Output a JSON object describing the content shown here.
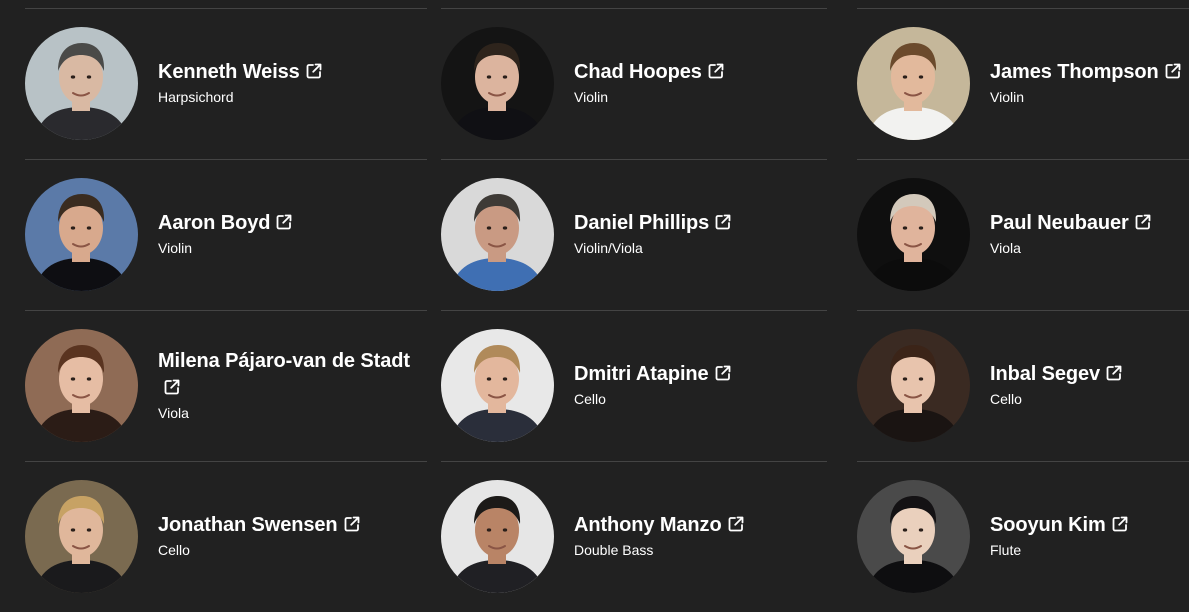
{
  "artists": [
    {
      "name": "Kenneth Weiss",
      "role": "Harpsichord",
      "photo": "portrait-photo",
      "bg": "#b8c2c6",
      "skin": "#d9b9a3",
      "hair": "#4a4a48",
      "shirt": "#2a2a2e"
    },
    {
      "name": "Chad Hoopes",
      "role": "Violin",
      "photo": "portrait-photo",
      "bg": "#141414",
      "skin": "#dcb49e",
      "hair": "#2e241c",
      "shirt": "#101014"
    },
    {
      "name": "James Thompson",
      "role": "Violin",
      "photo": "portrait-photo",
      "bg": "#c5b79a",
      "skin": "#e2b99c",
      "hair": "#6b4a2c",
      "shirt": "#f2f2f0"
    },
    {
      "name": "Aaron Boyd",
      "role": "Violin",
      "photo": "portrait-photo",
      "bg": "#5b7aa8",
      "skin": "#d8a98d",
      "hair": "#3a2c20",
      "shirt": "#0e0e12"
    },
    {
      "name": "Daniel Phillips",
      "role": "Violin/Viola",
      "photo": "portrait-photo",
      "bg": "#d9d9d9",
      "skin": "#c99a83",
      "hair": "#3e3a36",
      "shirt": "#3f6fb3"
    },
    {
      "name": "Paul Neubauer",
      "role": "Viola",
      "photo": "portrait-photo",
      "bg": "#0f0f0f",
      "skin": "#e0b49c",
      "hair": "#d3c9bb",
      "shirt": "#0c0c0c"
    },
    {
      "name": "Milena Pájaro-van de Stadt",
      "role": "Viola",
      "photo": "portrait-photo",
      "bg": "#8f6b55",
      "skin": "#e6bda4",
      "hair": "#5a3420",
      "shirt": "#2b1c16"
    },
    {
      "name": "Dmitri Atapine",
      "role": "Cello",
      "photo": "portrait-photo",
      "bg": "#e8e8e8",
      "skin": "#e3b79d",
      "hair": "#b08a5a",
      "shirt": "#2a2e3a"
    },
    {
      "name": "Inbal Segev",
      "role": "Cello",
      "photo": "portrait-photo",
      "bg": "#3a2a22",
      "skin": "#e8c4ad",
      "hair": "#3b2418",
      "shirt": "#1a1412"
    },
    {
      "name": "Jonathan Swensen",
      "role": "Cello",
      "photo": "portrait-photo",
      "bg": "#7a6a50",
      "skin": "#e0b79b",
      "hair": "#c7a264",
      "shirt": "#1a1a1c"
    },
    {
      "name": "Anthony Manzo",
      "role": "Double Bass",
      "photo": "portrait-photo",
      "bg": "#e6e6e6",
      "skin": "#b98466",
      "hair": "#1c1a18",
      "shirt": "#202024"
    },
    {
      "name": "Sooyun Kim",
      "role": "Flute",
      "photo": "portrait-photo",
      "bg": "#4a4a4a",
      "skin": "#ead0bd",
      "hair": "#141214",
      "shirt": "#0e0e10"
    }
  ],
  "icons": {
    "external_link": "external-link-icon"
  },
  "colors": {
    "background": "#212121",
    "divider": "#444444",
    "text": "#ffffff"
  }
}
